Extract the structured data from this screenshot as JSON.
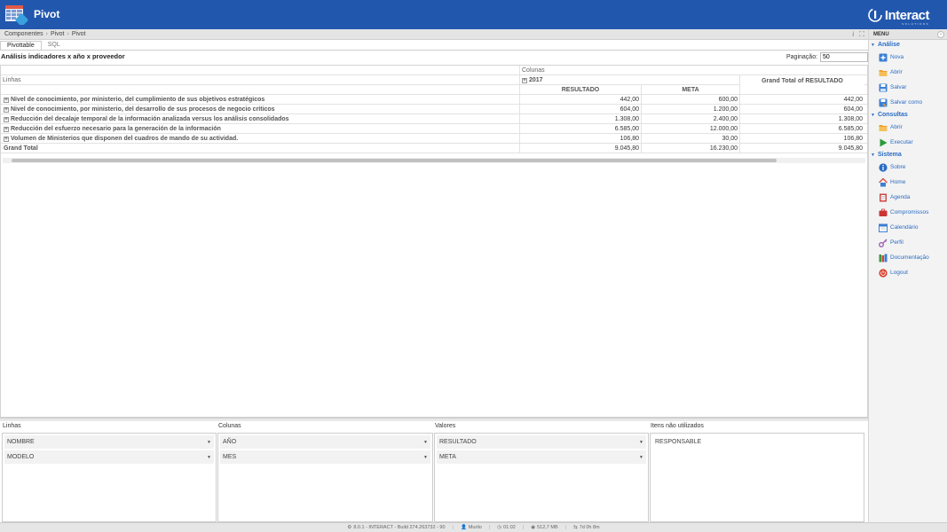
{
  "app": {
    "title": "Pivot",
    "brand": "Interact",
    "brand_sub": "SOLUTIONS"
  },
  "breadcrumb": [
    "Componentes",
    "Pivot",
    "Pivot"
  ],
  "tabs": [
    {
      "label": "Pivottable",
      "active": true
    },
    {
      "label": "SQL",
      "active": false
    }
  ],
  "report": {
    "title": "Análisis indicadores x año x proveedor",
    "pagination_label": "Paginação:",
    "pagination_value": "50"
  },
  "pivot": {
    "columns_label": "Colunas",
    "rows_label": "Linhas",
    "year": "2017",
    "measure_headers": [
      "RESULTADO",
      "META"
    ],
    "grand_total_header": "Grand Total of RESULTADO",
    "rows": [
      {
        "label": "Nivel de conocimiento, por ministerio, del cumplimiento de sus objetivos estratégicos",
        "resultado": "442,00",
        "meta": "600,00",
        "total": "442,00"
      },
      {
        "label": "Nivel de conocimiento, por ministerio, del desarrollo de sus procesos de negocio críticos",
        "resultado": "604,00",
        "meta": "1.200,00",
        "total": "604,00"
      },
      {
        "label": "Reducción del decalaje temporal de la información analizada versus los análisis consolidados",
        "resultado": "1.308,00",
        "meta": "2.400,00",
        "total": "1.308,00"
      },
      {
        "label": "Reducción del esfuerzo necesario para la generación de la información",
        "resultado": "6.585,00",
        "meta": "12.000,00",
        "total": "6.585,00"
      },
      {
        "label": "Volumen de Ministerios que disponen del cuadros de mando de su actividad.",
        "resultado": "106,80",
        "meta": "30,00",
        "total": "106,80"
      }
    ],
    "grand_total": {
      "label": "Grand Total",
      "resultado": "9.045,80",
      "meta": "16.230,00",
      "total": "9.045,80"
    }
  },
  "fields": {
    "linhas": {
      "title": "Linhas",
      "items": [
        "NOMBRE",
        "MODELO"
      ]
    },
    "colunas": {
      "title": "Colunas",
      "items": [
        "AÑO",
        "MES"
      ]
    },
    "valores": {
      "title": "Valores",
      "items": [
        "RESULTADO",
        "META"
      ]
    },
    "unused": {
      "title": "Itens não utilizados",
      "items": [
        "RESPONSABLE"
      ]
    }
  },
  "menu": {
    "title": "MENU",
    "sections": [
      {
        "label": "Análise",
        "items": [
          {
            "label": "Nova",
            "icon": "new-doc-icon",
            "color": "#3b7fd4"
          },
          {
            "label": "Abrir",
            "icon": "folder-open-icon",
            "color": "#f0a030"
          },
          {
            "label": "Salvar",
            "icon": "save-icon",
            "color": "#3b7fd4"
          },
          {
            "label": "Salvar como",
            "icon": "save-as-icon",
            "color": "#3b7fd4"
          }
        ]
      },
      {
        "label": "Consultas",
        "items": [
          {
            "label": "Abrir",
            "icon": "folder-open-icon",
            "color": "#f0a030"
          },
          {
            "label": "Executar",
            "icon": "play-icon",
            "color": "#2a9a3a"
          }
        ]
      },
      {
        "label": "Sistema",
        "items": [
          {
            "label": "Sobre",
            "icon": "info-icon",
            "color": "#2a6cc4"
          },
          {
            "label": "Home",
            "icon": "home-icon",
            "color": "#d94a3a"
          },
          {
            "label": "Agenda",
            "icon": "agenda-icon",
            "color": "#cc4444"
          },
          {
            "label": "Compromissos",
            "icon": "briefcase-icon",
            "color": "#cc3333"
          },
          {
            "label": "Calendário",
            "icon": "calendar-icon",
            "color": "#3b7fd4"
          },
          {
            "label": "Perfil",
            "icon": "key-icon",
            "color": "#9b59b6"
          },
          {
            "label": "Documentação",
            "icon": "books-icon",
            "color": "#3a9a3a"
          },
          {
            "label": "Logout",
            "icon": "power-icon",
            "color": "#d9412e"
          }
        ]
      }
    ]
  },
  "status": {
    "version": "8.0.1 - INTERACT - Build 274.263732 - 90",
    "user": "Murilo",
    "time": "01:02",
    "memory": "512,7 MB",
    "uptime": "7d 0h 8m"
  }
}
